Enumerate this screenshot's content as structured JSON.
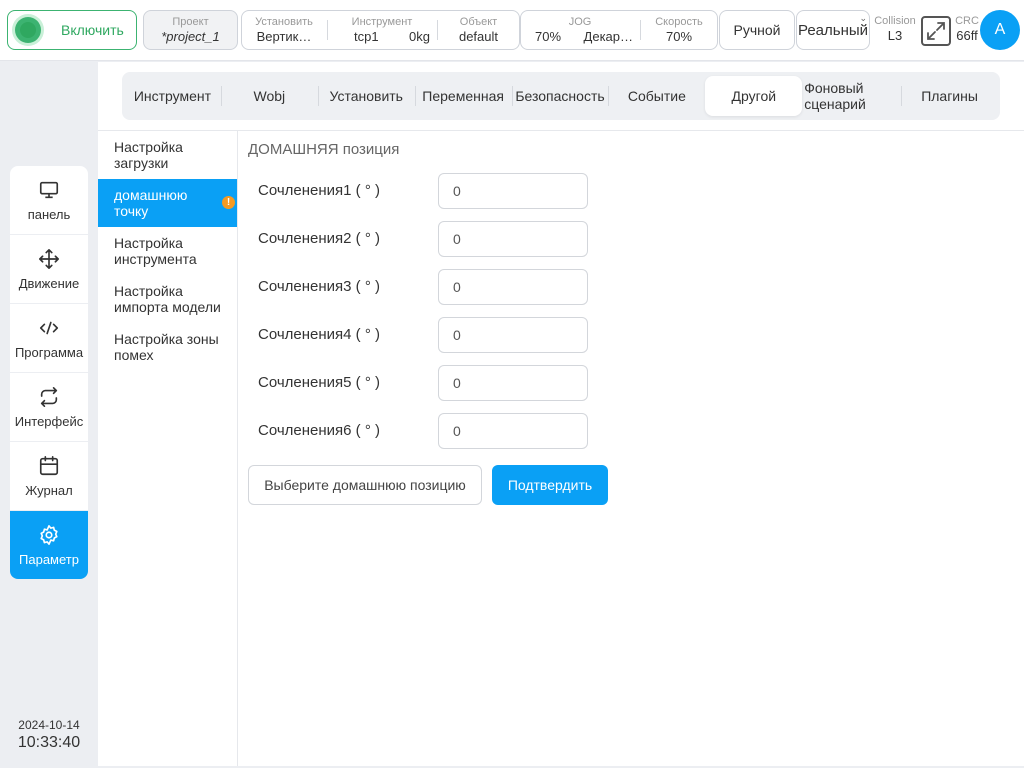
{
  "topbar": {
    "enable_label": "Включить",
    "project": {
      "label": "Проект",
      "value": "*project_1"
    },
    "setup": {
      "label": "Установить",
      "value": "Вертик…"
    },
    "tool": {
      "label": "Инструмент",
      "name": "tcp1",
      "mass": "0kg"
    },
    "object": {
      "label": "Объект",
      "value": "default"
    },
    "jog": {
      "label": "JOG",
      "percent": "70%",
      "mode": "Декар…"
    },
    "speed": {
      "label": "Скорость",
      "value": "70%"
    },
    "manual_label": "Ручной",
    "real_label": "Реальный",
    "collision": {
      "label": "Collision",
      "value": "L3"
    },
    "crc": {
      "label": "CRC",
      "value": "66ff"
    },
    "avatar_letter": "A"
  },
  "leftnav": {
    "items": [
      {
        "label": "панель",
        "icon": "monitor-icon"
      },
      {
        "label": "Движение",
        "icon": "move-arrows-icon"
      },
      {
        "label": "Программа",
        "icon": "code-icon"
      },
      {
        "label": "Интерфейс",
        "icon": "swap-arrows-icon"
      },
      {
        "label": "Журнал",
        "icon": "calendar-icon"
      },
      {
        "label": "Параметр",
        "icon": "gear-icon",
        "active": true
      }
    ],
    "date": "2024-10-14",
    "time": "10:33:40"
  },
  "tabs": [
    {
      "label": "Инструмент"
    },
    {
      "label": "Wobj"
    },
    {
      "label": "Установить"
    },
    {
      "label": "Переменная"
    },
    {
      "label": "Безопасность"
    },
    {
      "label": "Событие"
    },
    {
      "label": "Другой",
      "active": true
    },
    {
      "label": "Фоновый сценарий"
    },
    {
      "label": "Плагины"
    }
  ],
  "subnav": [
    {
      "label": "Настройка загрузки"
    },
    {
      "label": "домашнюю точку",
      "active": true,
      "warning": "!"
    },
    {
      "label": "Настройка инструмента"
    },
    {
      "label": "Настройка импорта модели"
    },
    {
      "label": "Настройка зоны помех"
    }
  ],
  "home": {
    "title": "ДОМАШНЯЯ позиция",
    "joints": [
      {
        "label": "Сочленения1 ( ° )",
        "value": "0"
      },
      {
        "label": "Сочленения2 ( ° )",
        "value": "0"
      },
      {
        "label": "Сочленения3 ( ° )",
        "value": "0"
      },
      {
        "label": "Сочленения4 ( ° )",
        "value": "0"
      },
      {
        "label": "Сочленения5 ( ° )",
        "value": "0"
      },
      {
        "label": "Сочленения6 ( ° )",
        "value": "0"
      }
    ],
    "select_button": "Выберите домашнюю позицию",
    "confirm_button": "Подтвердить"
  },
  "colors": {
    "accent": "#0aa0f5",
    "enable_green": "#3cb371",
    "warning": "#f59a23"
  }
}
